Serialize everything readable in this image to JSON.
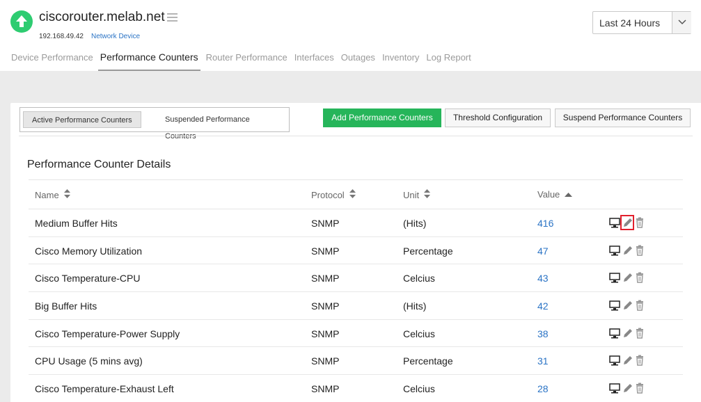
{
  "device": {
    "name": "ciscorouter.melab.net",
    "ip": "192.168.49.42",
    "type": "Network Device",
    "status_color": "#2ecc71"
  },
  "time_range": {
    "selected": "Last 24 Hours"
  },
  "tabs": [
    {
      "label": "Device Performance"
    },
    {
      "label": "Performance Counters",
      "active": true
    },
    {
      "label": "Router Performance"
    },
    {
      "label": "Interfaces"
    },
    {
      "label": "Outages"
    },
    {
      "label": "Inventory"
    },
    {
      "label": "Log Report"
    }
  ],
  "toggle": {
    "active_label": "Active Performance Counters",
    "suspended_label": "Suspended Performance Counters"
  },
  "actions": {
    "add": "Add Performance Counters",
    "threshold": "Threshold Configuration",
    "suspend": "Suspend Performance Counters"
  },
  "section_title": "Performance Counter Details",
  "table": {
    "columns": {
      "name": "Name",
      "protocol": "Protocol",
      "unit": "Unit",
      "value": "Value"
    },
    "rows": [
      {
        "name": "Medium Buffer Hits",
        "protocol": "SNMP",
        "unit": "(Hits)",
        "value": "416"
      },
      {
        "name": "Cisco Memory Utilization",
        "protocol": "SNMP",
        "unit": "Percentage",
        "value": "47"
      },
      {
        "name": "Cisco Temperature-CPU",
        "protocol": "SNMP",
        "unit": "Celcius",
        "value": "43"
      },
      {
        "name": "Big Buffer Hits",
        "protocol": "SNMP",
        "unit": "(Hits)",
        "value": "42"
      },
      {
        "name": "Cisco Temperature-Power Supply",
        "protocol": "SNMP",
        "unit": "Celcius",
        "value": "38"
      },
      {
        "name": "CPU Usage (5 mins avg)",
        "protocol": "SNMP",
        "unit": "Percentage",
        "value": "31"
      },
      {
        "name": "Cisco Temperature-Exhaust Left",
        "protocol": "SNMP",
        "unit": "Celcius",
        "value": "28"
      }
    ]
  },
  "colors": {
    "accent_green": "#26b55a",
    "link_blue": "#2a73c5",
    "highlight_red": "#e2202d"
  }
}
